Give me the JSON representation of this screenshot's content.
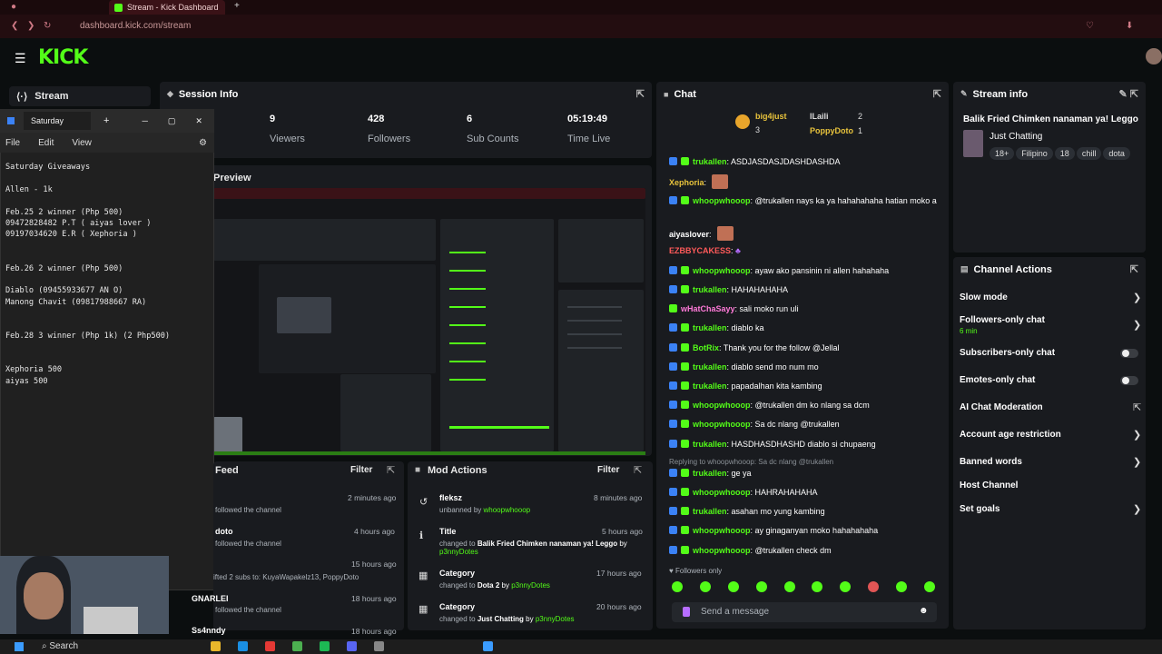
{
  "browser": {
    "tab_title": "Stream - Kick Dashboard",
    "url": "dashboard.kick.com/stream"
  },
  "kick": {
    "logo": "KICK",
    "sidebar_item": "Stream"
  },
  "notepad": {
    "tab_title": "Saturday",
    "menu": [
      "File",
      "Edit",
      "View"
    ],
    "content": "Saturday Giveaways\n\nAllen - 1k\n\nFeb.25 2 winner (Php 500)\n09472828482 P.T ( aiyas lover )\n09197034620 E.R ( Xephoria )\n\n\nFeb.26 2 winner (Php 500)\n\nDiablo (09455933677 AN O)\nManong Chavit (09817988667 RA)\n\n\nFeb.28 3 winner (Php 1k) (2 Php500)\n\n\nXephoria 500\naiyas 500"
  },
  "session": {
    "title": "Session Info",
    "stats": [
      {
        "value": "9",
        "label": "Viewers"
      },
      {
        "value": "428",
        "label": "Followers"
      },
      {
        "value": "6",
        "label": "Sub Counts"
      },
      {
        "value": "05:19:49",
        "label": "Time Live"
      }
    ]
  },
  "preview": {
    "title": "Preview"
  },
  "chat": {
    "title": "Chat",
    "top_users": [
      {
        "name": "big4just",
        "count": "3"
      },
      {
        "name": "lLaili",
        "count": "2"
      },
      {
        "name": "PoppyDoto",
        "count": "1"
      }
    ],
    "messages": [
      {
        "user": "trukallen",
        "text": "ASDJASDASJDASHDASHDA"
      },
      {
        "user": "Xephoria",
        "text": ""
      },
      {
        "user": "whoopwhooop",
        "text": "@trukallen nays ka ya hahahahaha hatian moko a"
      },
      {
        "user": "aiyaslover",
        "text": ""
      },
      {
        "user": "EZBBYCAKESS",
        "text": ""
      },
      {
        "user": "whoopwhooop",
        "text": "ayaw ako pansinin ni allen hahahaha"
      },
      {
        "user": "trukallen",
        "text": "HAHAHAHAHA"
      },
      {
        "user": "wHatChaSayy",
        "text": "sali moko run uli"
      },
      {
        "user": "trukallen",
        "text": "diablo ka"
      },
      {
        "user": "BotRix",
        "text": "Thank you for the follow @Jellal"
      },
      {
        "user": "trukallen",
        "text": "diablo send mo num mo"
      },
      {
        "user": "trukallen",
        "text": "papadalhan kita kambing"
      },
      {
        "user": "whoopwhooop",
        "text": "@trukallen dm ko nlang sa dcm"
      },
      {
        "user": "whoopwhooop",
        "text": "Sa dc nlang @trukallen"
      },
      {
        "user": "trukallen",
        "text": "HASDHASDHASHD diablo si chupaeng"
      },
      {
        "user": "trukallen",
        "text": "ge ya",
        "reply": "Replying to whoopwhooop: Sa dc nlang @trukallen"
      },
      {
        "user": "whoopwhooop",
        "text": "HAHRAHAHAHA"
      },
      {
        "user": "trukallen",
        "text": "asahan mo yung kambing"
      },
      {
        "user": "whoopwhooop",
        "text": "ay ginaganyan moko hahahahaha"
      },
      {
        "user": "whoopwhooop",
        "text": "@trukallen check dm"
      }
    ],
    "followers_only": "Followers only",
    "placeholder": "Send a message"
  },
  "stream_info": {
    "title": "Stream info",
    "stream_title": "Balik Fried Chimken nanaman ya! Leggo",
    "category": "Just Chatting",
    "tags": [
      "18+",
      "Filipino",
      "18",
      "chill",
      "dota"
    ]
  },
  "channel_actions": {
    "title": "Channel Actions",
    "items": [
      {
        "label": "Slow mode"
      },
      {
        "label": "Followers-only chat",
        "sub": "6 min"
      },
      {
        "label": "Subscribers-only chat"
      },
      {
        "label": "Emotes-only chat"
      },
      {
        "label": "AI Chat Moderation"
      },
      {
        "label": "Account age restriction"
      },
      {
        "label": "Banned words"
      },
      {
        "label": "Host Channel"
      },
      {
        "label": "Set goals"
      }
    ]
  },
  "feed": {
    "title": "Feed",
    "filter": "Filter",
    "items": [
      {
        "name": "",
        "sub": "followed the channel",
        "time": "2 minutes ago"
      },
      {
        "name": "doto",
        "sub": "followed the channel",
        "time": "4 hours ago"
      },
      {
        "name": "",
        "sub": "ifted 2 subs to: KuyaWapakelz13, PoppyDoto",
        "time": "15 hours ago"
      },
      {
        "name": "GNARLEI",
        "sub": "followed the channel",
        "time": "18 hours ago"
      },
      {
        "name": "Ss4nndy",
        "sub": "",
        "time": "18 hours ago"
      }
    ]
  },
  "mod_actions": {
    "title": "Mod Actions",
    "filter": "Filter",
    "items": [
      {
        "title": "fleksz",
        "sub": "unbanned by",
        "by": "whoopwhooop",
        "time": "8 minutes ago"
      },
      {
        "title": "Title",
        "sub": "changed to",
        "value": "Balik Fried Chimken nanaman ya! Leggo",
        "by": "p3nnyDotes",
        "time": "5 hours ago"
      },
      {
        "title": "Category",
        "sub": "changed to",
        "value": "Dota 2",
        "by": "p3nnyDotes",
        "time": "17 hours ago"
      },
      {
        "title": "Category",
        "sub": "changed to",
        "value": "Just Chatting",
        "by": "p3nnyDotes",
        "time": "20 hours ago"
      }
    ]
  },
  "taskbar": {
    "search": "Search"
  },
  "colors": {
    "kick_green": "#53fc18",
    "panel": "#191b1f",
    "background": "#0b0e0f"
  }
}
